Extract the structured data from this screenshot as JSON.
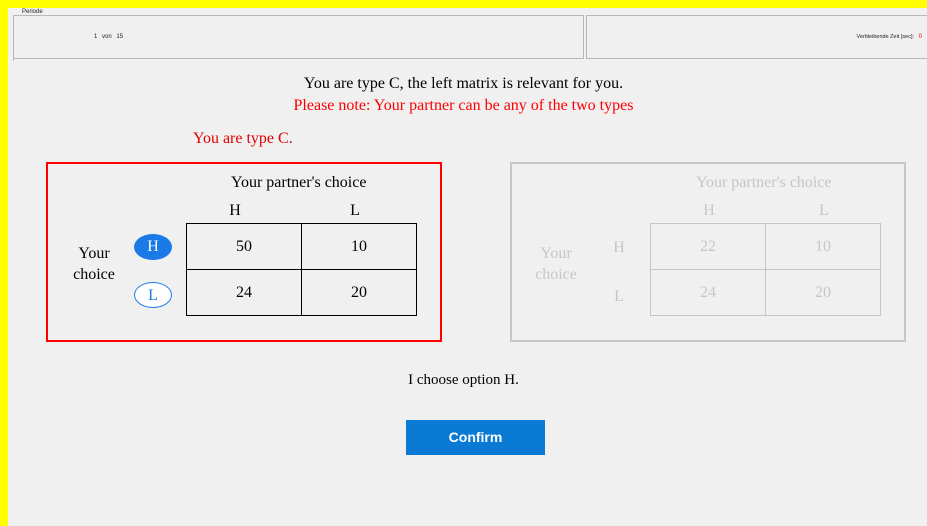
{
  "header": {
    "period_legend": "Periode",
    "period_current": "1",
    "period_of": "von",
    "period_total": "15",
    "timer_label": "Verbleibende Zeit [sec]:",
    "timer_value": "0"
  },
  "instructions": {
    "line1": "You are type C, the left matrix is relevant for you.",
    "line2": "Please note: Your partner can be any of the two types"
  },
  "type_label": "You are type C.",
  "matrix_left": {
    "partner_label": "Your partner's choice",
    "col_h": "H",
    "col_l": "L",
    "your_line1": "Your",
    "your_line2": "choice",
    "row_h": "H",
    "row_l": "L",
    "values": [
      [
        "50",
        "10"
      ],
      [
        "24",
        "20"
      ]
    ],
    "selected_row": "H"
  },
  "matrix_right": {
    "partner_label": "Your partner's choice",
    "col_h": "H",
    "col_l": "L",
    "your_line1": "Your",
    "your_line2": "choice",
    "row_h": "H",
    "row_l": "L",
    "values": [
      [
        "22",
        "10"
      ],
      [
        "24",
        "20"
      ]
    ]
  },
  "chosen_text": "I choose option H.",
  "confirm_label": "Confirm",
  "colors": {
    "window_border": "#ffff00",
    "active_frame": "#ff0000",
    "accent_blue": "#1a7be6",
    "button_blue": "#0a7ad4"
  }
}
